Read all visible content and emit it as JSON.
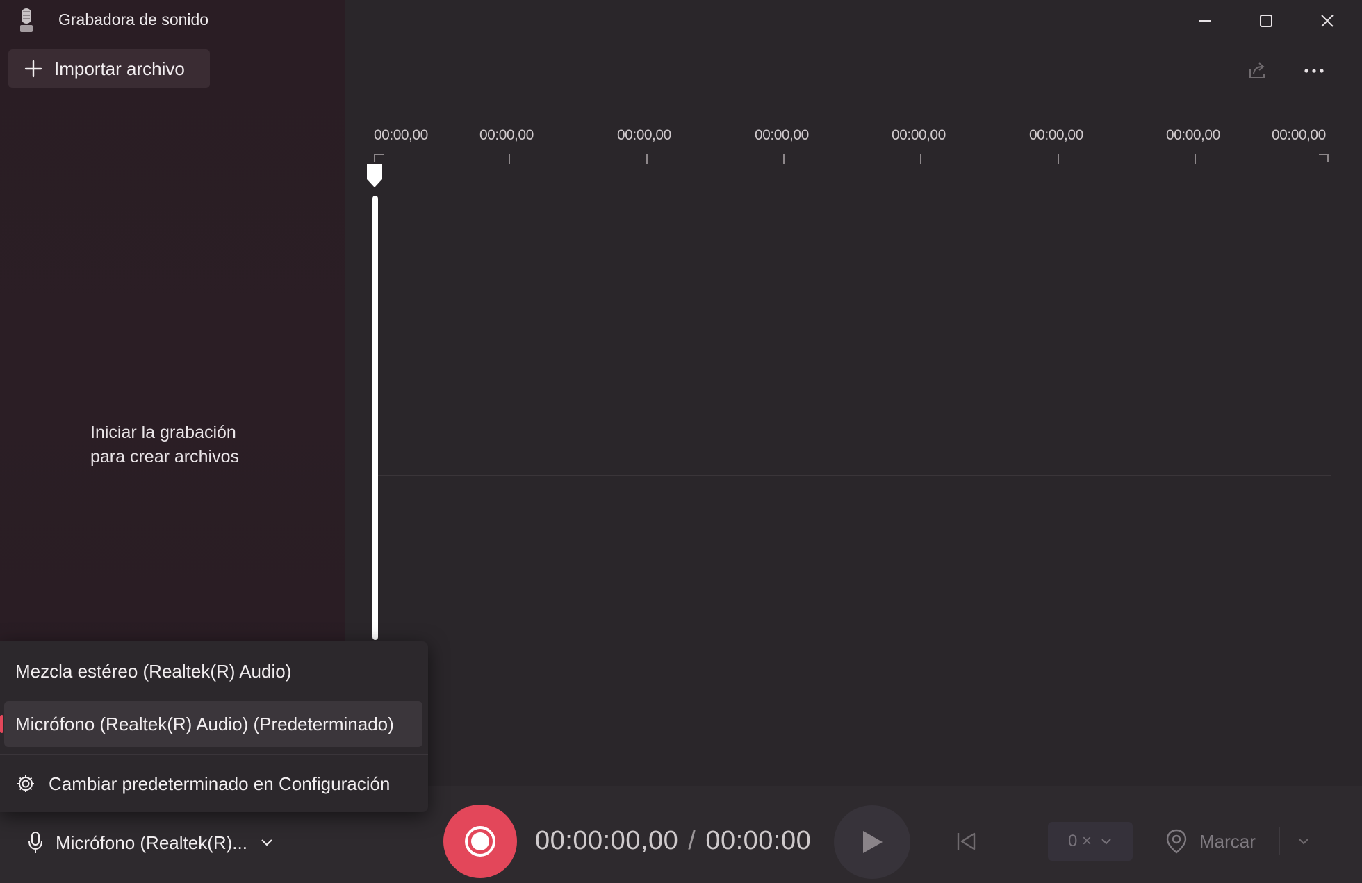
{
  "window": {
    "title": "Grabadora de sonido",
    "icons": {
      "app": "microphone-app-icon",
      "minimize": "minimize-icon",
      "maximize": "maximize-icon",
      "close": "close-icon"
    }
  },
  "sidebar": {
    "import_label": "Importar archivo",
    "empty_line1": "Iniciar la grabación",
    "empty_line2": "para crear archivos"
  },
  "toolbar": {
    "share_icon": "share-icon",
    "more_icon": "more-options-icon"
  },
  "timeline": {
    "ticks": [
      "00:00,00",
      "00:00,00",
      "00:00,00",
      "00:00,00",
      "00:00,00",
      "00:00,00",
      "00:00,00",
      "00:00,00"
    ]
  },
  "device_menu": {
    "items": [
      {
        "label": "Mezcla estéreo (Realtek(R) Audio)",
        "selected": false
      },
      {
        "label": "Micrófono (Realtek(R) Audio) (Predeterminado)",
        "selected": true
      }
    ],
    "settings_label": "Cambiar predeterminado en Configuración"
  },
  "bottombar": {
    "mic_label": "Micrófono (Realtek(R)...",
    "current_time": "00:00:00,00",
    "separator": "/",
    "total_time": "00:00:00",
    "speed_label": "0 ×",
    "mark_label": "Marcar"
  },
  "colors": {
    "accent": "#e3475a",
    "sidebar_bg": "#2a1d24",
    "main_bg": "#2a262a",
    "bar_bg": "#2e2a2e"
  }
}
